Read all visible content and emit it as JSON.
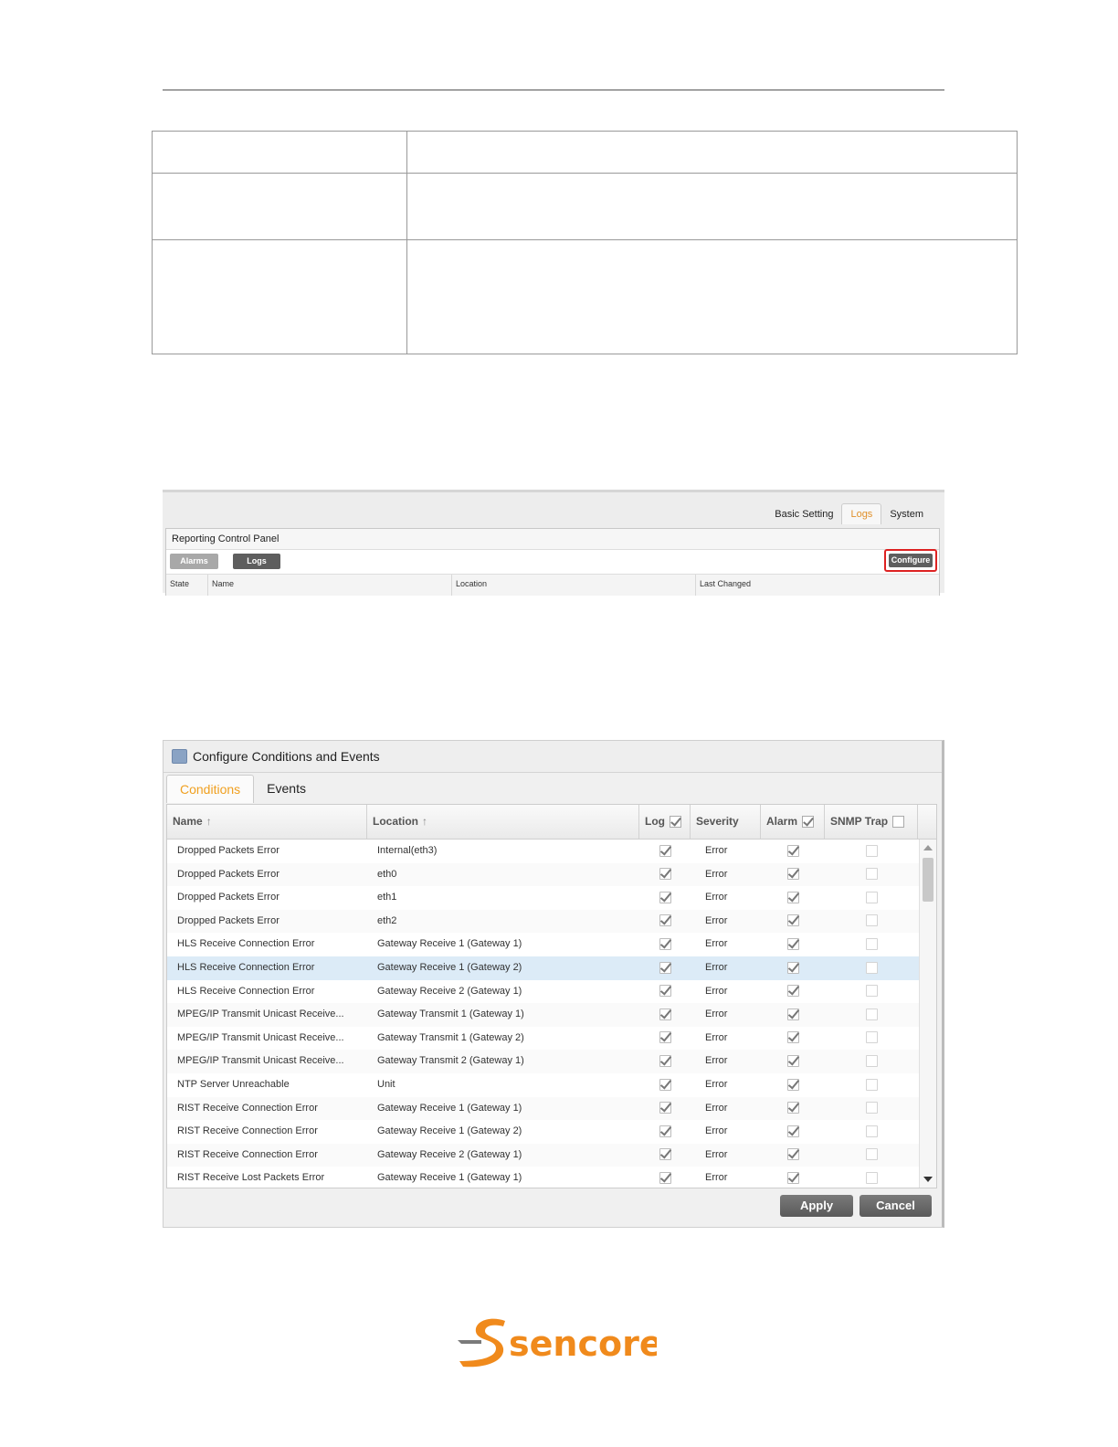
{
  "reporting_panel": {
    "tabs": [
      {
        "label": "Basic Setting",
        "active": false
      },
      {
        "label": "Logs",
        "active": true
      },
      {
        "label": "System",
        "active": false
      }
    ],
    "title": "Reporting Control Panel",
    "alarms_button": "Alarms",
    "logs_button": "Logs",
    "configure_button": "Configure",
    "columns": [
      "State",
      "Name",
      "Location",
      "Last Changed"
    ]
  },
  "dialog": {
    "title": "Configure Conditions and Events",
    "tabs": [
      {
        "label": "Conditions",
        "active": true
      },
      {
        "label": "Events",
        "active": false
      }
    ],
    "columns": {
      "name": "Name",
      "location": "Location",
      "log": "Log",
      "severity": "Severity",
      "alarm": "Alarm",
      "snmp_trap": "SNMP Trap"
    },
    "header_checks": {
      "log": true,
      "alarm": true,
      "snmp_trap": false
    },
    "rows": [
      {
        "name": "Dropped Packets Error",
        "location": "Internal(eth3)",
        "log": true,
        "severity": "Error",
        "alarm": true,
        "snmp": false
      },
      {
        "name": "Dropped Packets Error",
        "location": "eth0",
        "log": true,
        "severity": "Error",
        "alarm": true,
        "snmp": false
      },
      {
        "name": "Dropped Packets Error",
        "location": "eth1",
        "log": true,
        "severity": "Error",
        "alarm": true,
        "snmp": false
      },
      {
        "name": "Dropped Packets Error",
        "location": "eth2",
        "log": true,
        "severity": "Error",
        "alarm": true,
        "snmp": false
      },
      {
        "name": "HLS Receive Connection Error",
        "location": "Gateway Receive 1 (Gateway 1)",
        "log": true,
        "severity": "Error",
        "alarm": true,
        "snmp": false
      },
      {
        "name": "HLS Receive Connection Error",
        "location": "Gateway Receive 1 (Gateway 2)",
        "log": true,
        "severity": "Error",
        "alarm": true,
        "snmp": false,
        "selected": true
      },
      {
        "name": "HLS Receive Connection Error",
        "location": "Gateway Receive 2 (Gateway 1)",
        "log": true,
        "severity": "Error",
        "alarm": true,
        "snmp": false
      },
      {
        "name": "MPEG/IP Transmit Unicast Receive...",
        "location": "Gateway Transmit 1 (Gateway 1)",
        "log": true,
        "severity": "Error",
        "alarm": true,
        "snmp": false
      },
      {
        "name": "MPEG/IP Transmit Unicast Receive...",
        "location": "Gateway Transmit 1 (Gateway 2)",
        "log": true,
        "severity": "Error",
        "alarm": true,
        "snmp": false
      },
      {
        "name": "MPEG/IP Transmit Unicast Receive...",
        "location": "Gateway Transmit 2 (Gateway 1)",
        "log": true,
        "severity": "Error",
        "alarm": true,
        "snmp": false
      },
      {
        "name": "NTP Server Unreachable",
        "location": "Unit",
        "log": true,
        "severity": "Error",
        "alarm": true,
        "snmp": false
      },
      {
        "name": "RIST Receive Connection Error",
        "location": "Gateway Receive 1 (Gateway 1)",
        "log": true,
        "severity": "Error",
        "alarm": true,
        "snmp": false
      },
      {
        "name": "RIST Receive Connection Error",
        "location": "Gateway Receive 1 (Gateway 2)",
        "log": true,
        "severity": "Error",
        "alarm": true,
        "snmp": false
      },
      {
        "name": "RIST Receive Connection Error",
        "location": "Gateway Receive 2 (Gateway 1)",
        "log": true,
        "severity": "Error",
        "alarm": true,
        "snmp": false
      },
      {
        "name": "RIST Receive Lost Packets Error",
        "location": "Gateway Receive 1 (Gateway 1)",
        "log": true,
        "severity": "Error",
        "alarm": true,
        "snmp": false
      }
    ],
    "apply_button": "Apply",
    "cancel_button": "Cancel"
  },
  "logo": {
    "text": "sencore",
    "color": "#f08a1c",
    "mark_color": "#7a7a7a"
  }
}
